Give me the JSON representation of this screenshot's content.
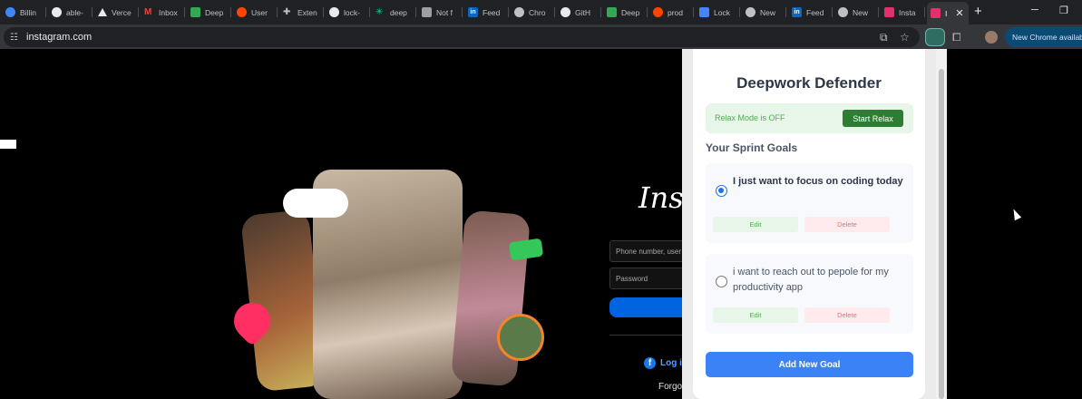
{
  "browser": {
    "tabs": [
      {
        "label": "Billin",
        "icon": "globe-icon",
        "color": "#4285f4"
      },
      {
        "label": "able-",
        "icon": "github-icon",
        "color": "#e8eaed"
      },
      {
        "label": "Verce",
        "icon": "vercel-icon",
        "color": "#e8eaed"
      },
      {
        "label": "Inbox",
        "icon": "gmail-icon",
        "color": "#ea4335"
      },
      {
        "label": "Deep",
        "icon": "deepwork-icon",
        "color": "#34a853"
      },
      {
        "label": "User",
        "icon": "reddit-icon",
        "color": "#ff4500"
      },
      {
        "label": "Exten",
        "icon": "puzzle-icon",
        "color": "#bdc1c6"
      },
      {
        "label": "lock-",
        "icon": "github-icon",
        "color": "#e8eaed"
      },
      {
        "label": "deep",
        "icon": "perplexity-icon",
        "color": "#20c997"
      },
      {
        "label": "Not f",
        "icon": "page-icon",
        "color": "#9aa0a6"
      },
      {
        "label": "Feed",
        "icon": "linkedin-icon",
        "color": "#0a66c2"
      },
      {
        "label": "Chro",
        "icon": "chrome-icon",
        "color": "#bdc1c6"
      },
      {
        "label": "GitH",
        "icon": "github-icon",
        "color": "#e8eaed"
      },
      {
        "label": "Deep",
        "icon": "deepwork-icon",
        "color": "#34a853"
      },
      {
        "label": "prod",
        "icon": "reddit-icon",
        "color": "#ff4500"
      },
      {
        "label": "Lock",
        "icon": "docs-icon",
        "color": "#4285f4"
      },
      {
        "label": "New",
        "icon": "chrome-icon",
        "color": "#bdc1c6"
      },
      {
        "label": "Feed",
        "icon": "linkedin-icon",
        "color": "#0a66c2"
      },
      {
        "label": "New",
        "icon": "chrome-icon",
        "color": "#bdc1c6"
      },
      {
        "label": "Insta",
        "icon": "instagram-icon",
        "color": "#e1306c"
      }
    ],
    "active_tab": {
      "label": "I",
      "icon": "instagram-icon",
      "color": "#e1306c",
      "close": "✕"
    },
    "new_tab": "+",
    "url": "instagram.com",
    "update_label": "New Chrome available"
  },
  "instagram": {
    "logo_text": "Inst",
    "phone_placeholder": "Phone number, user",
    "password_placeholder": "Password",
    "facebook_login": "Log i",
    "forgot": "Forgo"
  },
  "popup": {
    "title": "Deepwork Defender",
    "relax_status": "Relax Mode is OFF",
    "relax_button": "Start Relax",
    "goals_heading": "Your Sprint Goals",
    "goals": [
      {
        "text": "I just want to focus on coding today",
        "selected": true,
        "edit": "Edit",
        "delete": "Delete"
      },
      {
        "text": "i want to reach out to pepole for my productivity app",
        "selected": false,
        "edit": "Edit",
        "delete": "Delete"
      }
    ],
    "add_button": "Add New Goal",
    "colors": {
      "primary": "#3b82f6",
      "relax_green": "#2e7d32",
      "delete_red": "#e57373"
    }
  }
}
